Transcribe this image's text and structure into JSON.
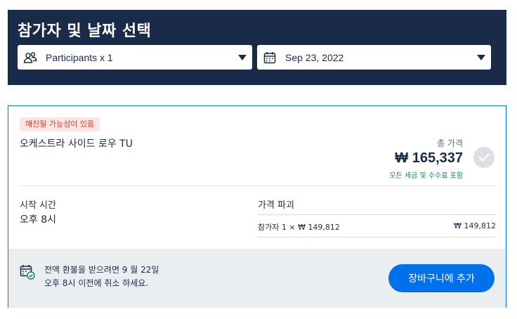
{
  "header": {
    "title": "참가자 및 날짜 선택",
    "participants_label": "Participants x 1",
    "date_label": "Sep 23, 2022"
  },
  "option": {
    "badge": "매진될 가능성이 있음",
    "title": "오케스트라 사이드 로우 TU",
    "total_label": "총 가격",
    "total_price": "₩ 165,337",
    "total_note": "모든 세금 및 수수료 포함",
    "start_label": "시작 시간",
    "start_value": "오후 8시",
    "breakdown_label": "가격 파괴",
    "breakdown_item": "참가자 1 × ₩ 149,812",
    "breakdown_amount": "₩ 149,812"
  },
  "footer": {
    "cancellation_line1": "전액 환불을 받으려면 9 월 22일",
    "cancellation_line2": "오후 8시 이전에 취소 하세요.",
    "cart_button": "장바구니에 추가"
  },
  "colors": {
    "navy": "#1a2b49",
    "accent_blue": "#0071eb",
    "badge_bg": "#fde6e3",
    "badge_text": "#d0453a",
    "note_green": "#0a8a5a"
  },
  "icons": {
    "participants": "people-icon",
    "date": "calendar-icon",
    "select": "check-icon",
    "cancellation": "calendar-check-icon"
  }
}
